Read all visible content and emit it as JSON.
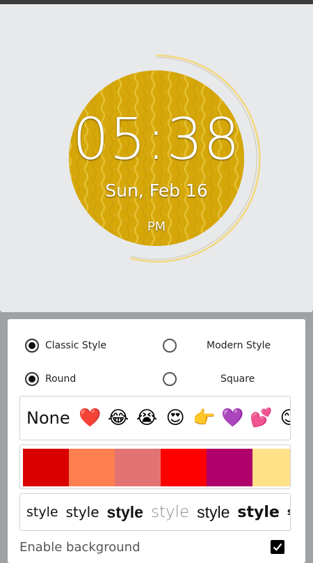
{
  "clock": {
    "time": "05:38",
    "date": "Sun, Feb 16",
    "ampm": "PM",
    "face_color": "#d5a709",
    "ring_color": "#f3d77a"
  },
  "style_options": {
    "classic": {
      "label": "Classic Style",
      "selected": true
    },
    "modern": {
      "label": "Modern Style",
      "selected": false
    }
  },
  "shape_options": {
    "round": {
      "label": "Round",
      "selected": true
    },
    "square": {
      "label": "Square",
      "selected": false
    }
  },
  "emoji_picker": {
    "none_label": "None",
    "items": [
      {
        "icon": "red-heart-icon",
        "glyph": "❤️"
      },
      {
        "icon": "tears-of-joy-icon",
        "glyph": "😂"
      },
      {
        "icon": "loudly-crying-icon",
        "glyph": "😭"
      },
      {
        "icon": "heart-eyes-icon",
        "glyph": "😍"
      },
      {
        "icon": "pointing-hand-icon",
        "glyph": "👉"
      },
      {
        "icon": "purple-heart-icon",
        "glyph": "💜"
      },
      {
        "icon": "two-hearts-icon",
        "glyph": "💕"
      },
      {
        "icon": "smiling-face-icon",
        "glyph": "😊"
      }
    ]
  },
  "color_picker": {
    "swatches": [
      "#d90000",
      "#ff7f50",
      "#e37373",
      "#ff0000",
      "#b0006b",
      "#ffe187"
    ]
  },
  "font_picker": {
    "items": [
      "style",
      "style",
      "style",
      "style",
      "style",
      "style",
      "style"
    ]
  },
  "background": {
    "label": "Enable background",
    "checked": true
  }
}
